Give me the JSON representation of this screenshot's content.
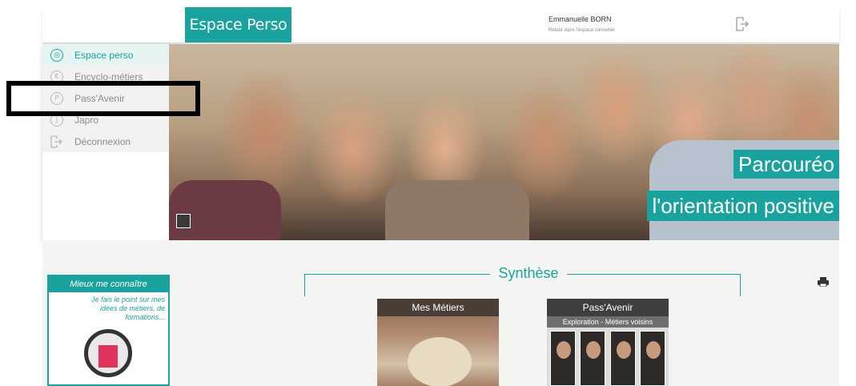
{
  "header": {
    "brand": "Espace Perso",
    "user_name": "Emmanuelle BORN",
    "user_sub": "Retour dans l'espace conseiller",
    "logout_icon": "logout-icon"
  },
  "sidebar": {
    "items": [
      {
        "label": "Espace perso",
        "icon": "espace-perso-icon",
        "glyph": "◎",
        "active": true
      },
      {
        "label": "Encyclo-métiers",
        "icon": "encyclo-icon",
        "glyph": "€",
        "active": false
      },
      {
        "label": "Pass'Avenir",
        "icon": "pass-avenir-icon",
        "glyph": "P",
        "active": false
      },
      {
        "label": "Japro",
        "icon": "japro-icon",
        "glyph": "J",
        "active": false
      },
      {
        "label": "Déconnexion",
        "icon": "logout-icon",
        "glyph": "",
        "active": false
      }
    ]
  },
  "hero": {
    "title": "Parcouréo",
    "subtitle": "l'orientation positive"
  },
  "know_card": {
    "title": "Mieux me connaître",
    "text": "Je fais le point sur mes idées de métiers, de formations..."
  },
  "synthese": {
    "title": "Synthèse",
    "cards": [
      {
        "title": "Mes Métiers"
      },
      {
        "title": "Pass'Avenir",
        "subtitle": "Exploration - Métiers voisins"
      }
    ]
  },
  "colors": {
    "accent": "#1aa39e",
    "card_header": "#4b3e37"
  }
}
